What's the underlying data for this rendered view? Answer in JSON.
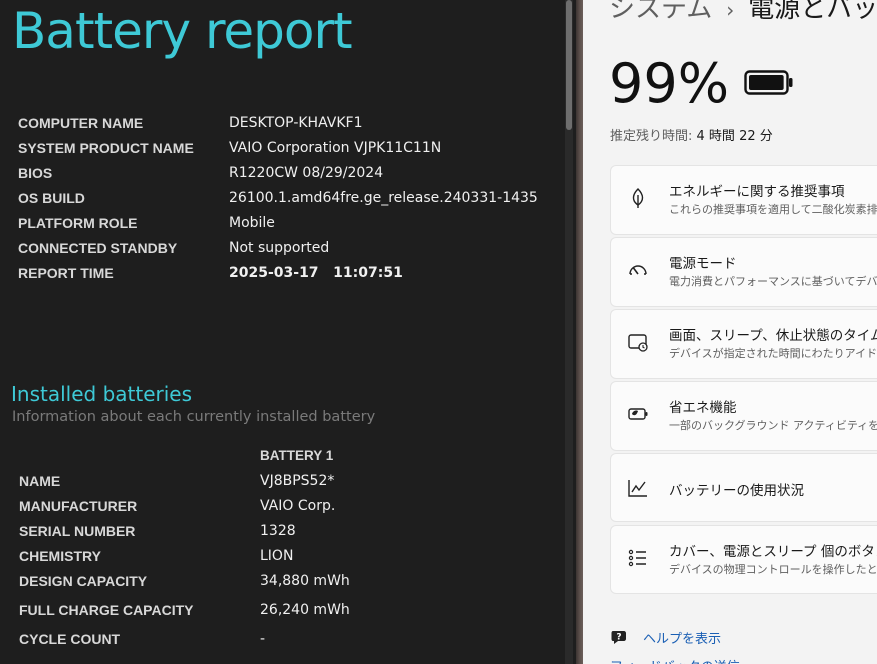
{
  "report": {
    "title": "Battery report",
    "system_info": [
      {
        "key": "COMPUTER NAME",
        "value": "DESKTOP-KHAVKF1"
      },
      {
        "key": "SYSTEM PRODUCT NAME",
        "value": "VAIO Corporation VJPK11C11N"
      },
      {
        "key": "BIOS",
        "value": "R1220CW 08/29/2024"
      },
      {
        "key": "OS BUILD",
        "value": "26100.1.amd64fre.ge_release.240331-1435"
      },
      {
        "key": "PLATFORM ROLE",
        "value": "Mobile"
      },
      {
        "key": "CONNECTED STANDBY",
        "value": "Not supported"
      },
      {
        "key": "REPORT TIME",
        "value": "2025-03-17   11:07:51"
      }
    ],
    "installed_batteries": {
      "title": "Installed batteries",
      "subtitle": "Information about each currently installed battery",
      "column_header": "BATTERY 1",
      "rows": [
        {
          "key": "NAME",
          "value": "VJ8BPS52*"
        },
        {
          "key": "MANUFACTURER",
          "value": "VAIO Corp."
        },
        {
          "key": "SERIAL NUMBER",
          "value": "1328"
        },
        {
          "key": "CHEMISTRY",
          "value": "LION"
        },
        {
          "key": "DESIGN CAPACITY",
          "value": "34,880 mWh"
        },
        {
          "key": "FULL CHARGE CAPACITY",
          "value": "26,240 mWh"
        },
        {
          "key": "CYCLE COUNT",
          "value": "-"
        }
      ]
    },
    "colors": {
      "accent": "#3ec9d6",
      "background": "#1e1e1e"
    }
  },
  "settings": {
    "breadcrumb": {
      "parent": "システム",
      "separator": "›",
      "current": "電源とバッテリー"
    },
    "battery_percent": "99%",
    "battery_level": 0.99,
    "remaining_label": "推定残り時間:",
    "remaining_value": "4 時間 22 分",
    "cards": [
      {
        "icon": "leaf-icon",
        "title": "エネルギーに関する推奨事項",
        "desc": "これらの推奨事項を適用して二酸化炭素排"
      },
      {
        "icon": "gauge-icon",
        "title": "電源モード",
        "desc": "電力消費とパフォーマンスに基づいてデバイスを"
      },
      {
        "icon": "screen-sleep-icon",
        "title": "画面、スリープ、休止状態のタイムアウ",
        "desc": "デバイスが指定された時間にわたりアイドル状"
      },
      {
        "icon": "battery-saver-icon",
        "title": "省エネ機能",
        "desc": "一部のバックグラウンド アクティビティを制限す"
      },
      {
        "icon": "chart-icon",
        "title": "バッテリーの使用状況",
        "desc": ""
      },
      {
        "icon": "list-settings-icon",
        "title": "カバー、電源とスリープ 個のボタン コント",
        "desc": "デバイスの物理コントロールを操作したときの動"
      }
    ],
    "help_link": "ヘルプを表示",
    "help_icon": "help-icon",
    "feedback_link": "フィードバックの送信",
    "colors": {
      "link": "#1a5fb4",
      "background": "#f3f3f3"
    }
  }
}
